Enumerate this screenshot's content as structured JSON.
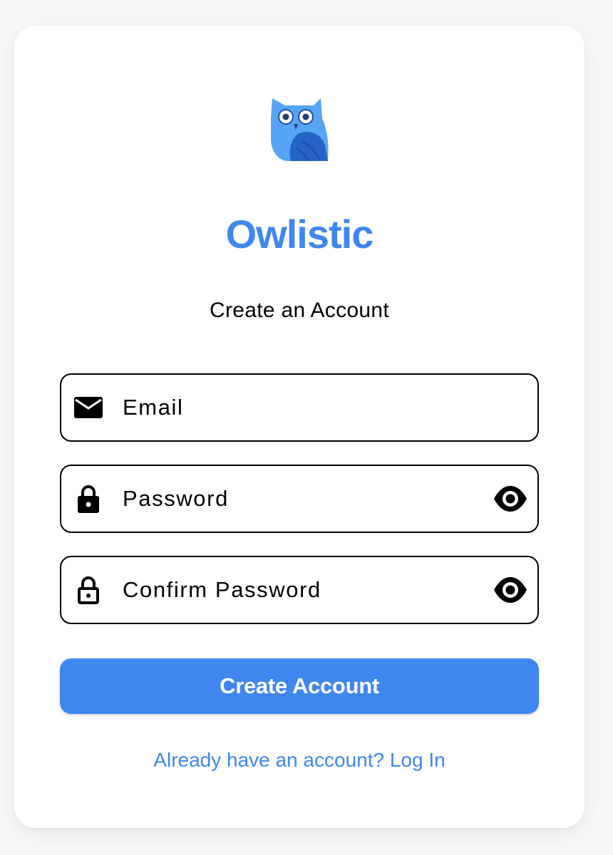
{
  "colors": {
    "accent": "#3f87ee",
    "owl_light": "#56a4f5",
    "owl_dark": "#2563c7",
    "owl_eye_ring": "#1f4fa8",
    "text": "#000000",
    "card": "#ffffff",
    "background": "#f7f7f8"
  },
  "brand": {
    "logo_icon": "owl-logo-icon",
    "name": "Owlistic"
  },
  "form": {
    "title": "Create an Account",
    "email": {
      "icon": "envelope-icon",
      "placeholder": "Email",
      "value": ""
    },
    "password": {
      "icon": "lock-icon",
      "placeholder": "Password",
      "value": "",
      "toggle_icon": "eye-icon"
    },
    "confirm_password": {
      "icon": "lock-outline-icon",
      "placeholder": "Confirm Password",
      "value": "",
      "toggle_icon": "eye-icon"
    },
    "submit_label": "Create Account",
    "login_link": "Already have an account? Log In"
  }
}
